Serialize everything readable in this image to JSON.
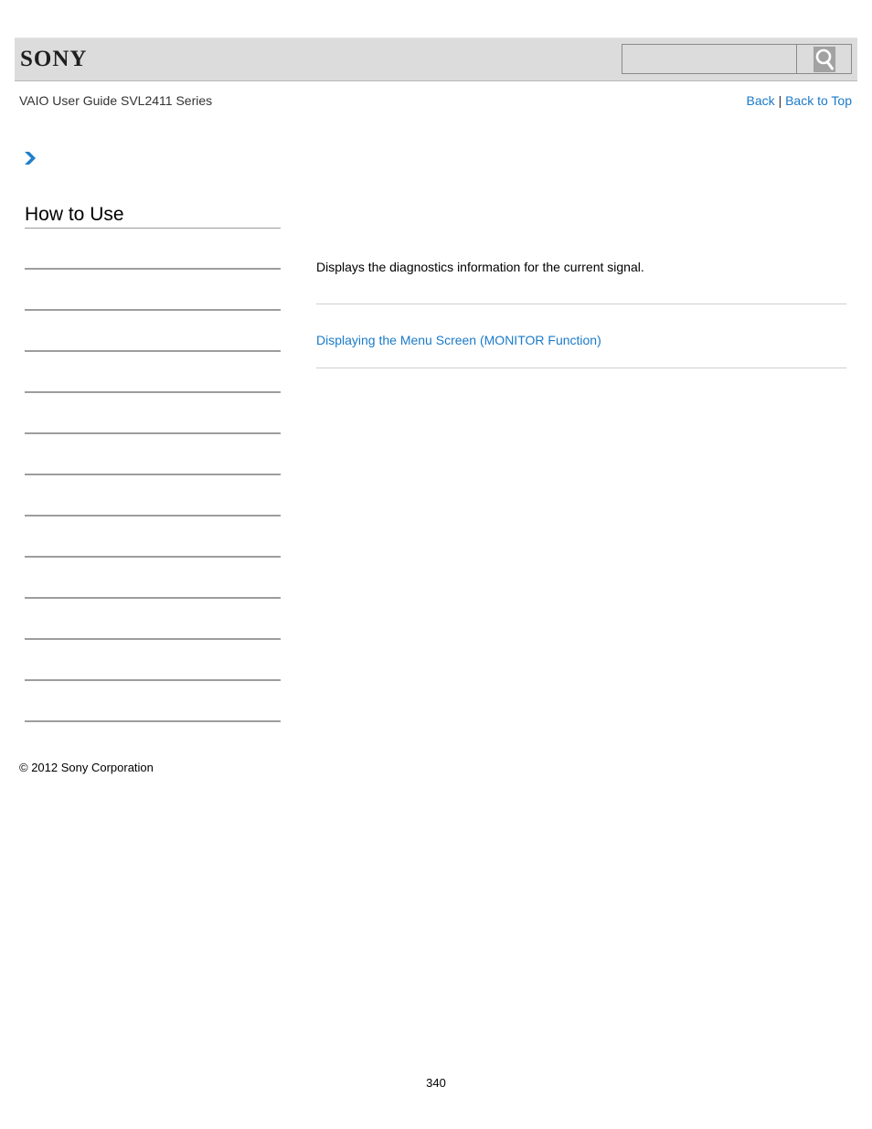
{
  "header": {
    "logo_text": "SONY",
    "search": {
      "value": "",
      "placeholder": ""
    },
    "search_icon": "search-icon"
  },
  "subheader": {
    "guide_title": "VAIO User Guide SVL2411 Series",
    "back_label": "Back",
    "separator": "|",
    "back_to_top_label": "Back to Top"
  },
  "breadcrumb": {
    "icon": "chevron-right-icon"
  },
  "sidebar": {
    "title": "How to Use",
    "items": [
      {
        "label": ""
      },
      {
        "label": ""
      },
      {
        "label": ""
      },
      {
        "label": ""
      },
      {
        "label": ""
      },
      {
        "label": ""
      },
      {
        "label": ""
      },
      {
        "label": ""
      },
      {
        "label": ""
      },
      {
        "label": ""
      },
      {
        "label": ""
      },
      {
        "label": ""
      }
    ]
  },
  "main": {
    "description": "Displays the diagnostics information for the current signal.",
    "related_link": "Displaying the Menu Screen (MONITOR Function)"
  },
  "footer": {
    "copyright": "© 2012 Sony Corporation"
  },
  "page_number": "340",
  "colors": {
    "link": "#1a7ac8",
    "header_bg": "#dcdcdc",
    "chevron": "#1f80c8"
  }
}
